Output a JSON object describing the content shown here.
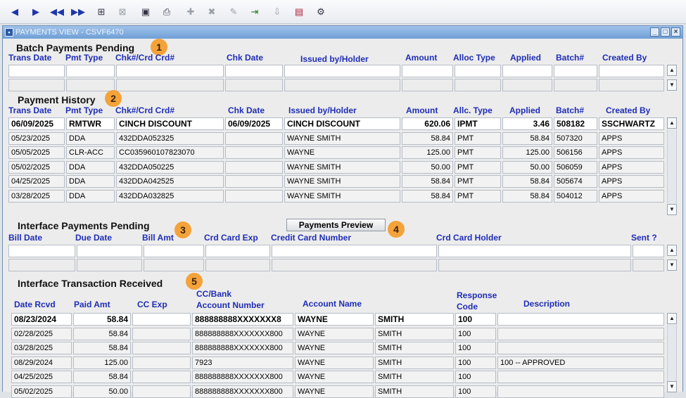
{
  "toolbar": {
    "icons": [
      "prev-icon",
      "next-icon",
      "first-icon",
      "last-icon",
      "query-icon",
      "cancel-query-icon",
      "form-icon",
      "print-icon",
      "insert-icon",
      "delete-icon",
      "edit-icon",
      "exit-icon",
      "download-icon",
      "report-icon",
      "tools-icon"
    ]
  },
  "window": {
    "title": "PAYMENTS VIEW - CSVF6470"
  },
  "batch": {
    "title": "Batch Payments Pending",
    "badge": "1",
    "headers": [
      "Trans Date",
      "Pmt Type",
      "Chk#/Crd Crd#",
      "Chk Date",
      "Issued by/Holder",
      "Amount",
      "Alloc Type",
      "Applied",
      "Batch#",
      "Created By"
    ]
  },
  "history": {
    "title": "Payment History",
    "badge": "2",
    "headers": [
      "Trans Date",
      "Pmt Type",
      "Chk#/Crd Crd#",
      "Chk Date",
      "Issued by/Holder",
      "Amount",
      "Allc. Type",
      "Applied",
      "Batch#",
      "Created By"
    ],
    "rows": [
      [
        "06/09/2025",
        "RMTWR",
        "CINCH DISCOUNT",
        "06/09/2025",
        "CINCH DISCOUNT",
        "620.06",
        "IPMT",
        "3.46",
        "508182",
        "SSCHWARTZ"
      ],
      [
        "05/23/2025",
        "DDA",
        "432DDA052325",
        "",
        "WAYNE SMITH",
        "58.84",
        "PMT",
        "58.84",
        "507320",
        "APPS"
      ],
      [
        "05/05/2025",
        "CLR-ACC",
        "CC035960107823070",
        "",
        "WAYNE",
        "125.00",
        "PMT",
        "125.00",
        "506156",
        "APPS"
      ],
      [
        "05/02/2025",
        "DDA",
        "432DDA050225",
        "",
        "WAYNE SMITH",
        "50.00",
        "PMT",
        "50.00",
        "506059",
        "APPS"
      ],
      [
        "04/25/2025",
        "DDA",
        "432DDA042525",
        "",
        "WAYNE SMITH",
        "58.84",
        "PMT",
        "58.84",
        "505674",
        "APPS"
      ],
      [
        "03/28/2025",
        "DDA",
        "432DDA032825",
        "",
        "WAYNE SMITH",
        "58.84",
        "PMT",
        "58.84",
        "504012",
        "APPS"
      ]
    ]
  },
  "interface_pending": {
    "title": "Interface Payments Pending",
    "badge": "3",
    "preview_button": "Payments Preview",
    "preview_badge": "4",
    "headers": [
      "Bill Date",
      "Due Date",
      "Bill Amt",
      "Crd Card Exp",
      "Credit Card Number",
      "Crd Card Holder",
      "Sent ?"
    ]
  },
  "received": {
    "title": "Interface Transaction Received",
    "badge": "5",
    "headers": [
      "Date Rcvd",
      "Paid Amt",
      "CC Exp",
      "CC/Bank",
      "Account Number",
      "Account Name",
      "Response",
      "Code",
      "Description"
    ],
    "rows": [
      [
        "08/23/2024",
        "58.84",
        "",
        "888888888XXXXXXX8",
        "WAYNE",
        "SMITH",
        "100",
        ""
      ],
      [
        "02/28/2025",
        "58.84",
        "",
        "888888888XXXXXXX800",
        "WAYNE",
        "SMITH",
        "100",
        ""
      ],
      [
        "03/28/2025",
        "58.84",
        "",
        "888888888XXXXXXX800",
        "WAYNE",
        "SMITH",
        "100",
        ""
      ],
      [
        "08/29/2024",
        "125.00",
        "",
        "7923",
        "WAYNE",
        "SMITH",
        "100",
        "100 -- APPROVED"
      ],
      [
        "04/25/2025",
        "58.84",
        "",
        "888888888XXXXXXX800",
        "WAYNE",
        "SMITH",
        "100",
        ""
      ],
      [
        "05/02/2025",
        "50.00",
        "",
        "888888888XXXXXXX800",
        "WAYNE",
        "SMITH",
        "100",
        ""
      ]
    ]
  }
}
